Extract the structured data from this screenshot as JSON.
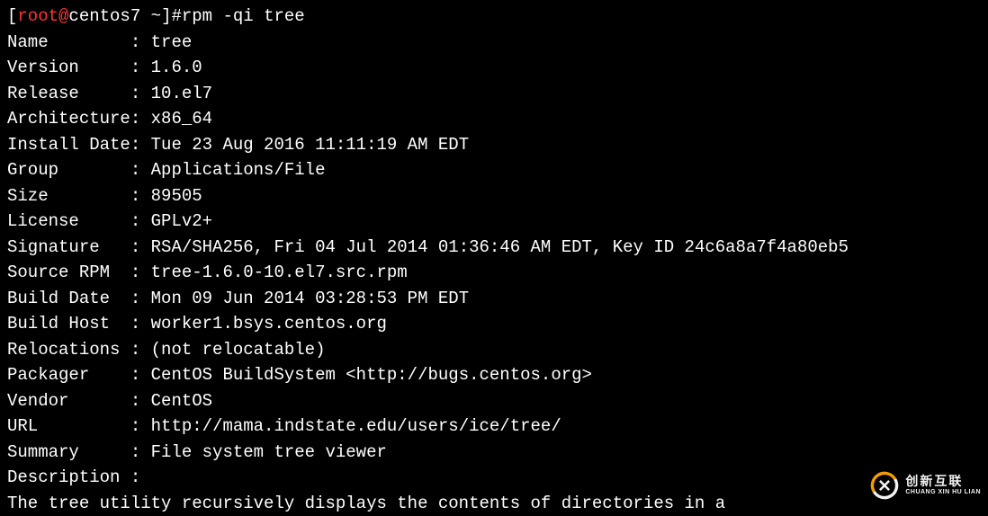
{
  "prompt": {
    "open_bracket": "[",
    "user": "root",
    "at": "@",
    "host": "centos7",
    "space1": " ",
    "path": "~",
    "close_bracket": "]",
    "hash": "#",
    "command": "rpm -qi tree"
  },
  "fields": {
    "name": {
      "label": "Name        ",
      "sep": ": ",
      "value": "tree"
    },
    "version": {
      "label": "Version     ",
      "sep": ": ",
      "value": "1.6.0"
    },
    "release": {
      "label": "Release     ",
      "sep": ": ",
      "value": "10.el7"
    },
    "architecture": {
      "label": "Architecture",
      "sep": ": ",
      "value": "x86_64"
    },
    "install_date": {
      "label": "Install Date",
      "sep": ": ",
      "value": "Tue 23 Aug 2016 11:11:19 AM EDT"
    },
    "group": {
      "label": "Group       ",
      "sep": ": ",
      "value": "Applications/File"
    },
    "size": {
      "label": "Size        ",
      "sep": ": ",
      "value": "89505"
    },
    "license": {
      "label": "License     ",
      "sep": ": ",
      "value": "GPLv2+"
    },
    "signature": {
      "label": "Signature   ",
      "sep": ": ",
      "value": "RSA/SHA256, Fri 04 Jul 2014 01:36:46 AM EDT, Key ID 24c6a8a7f4a80eb5"
    },
    "source_rpm": {
      "label": "Source RPM  ",
      "sep": ": ",
      "value": "tree-1.6.0-10.el7.src.rpm"
    },
    "build_date": {
      "label": "Build Date  ",
      "sep": ": ",
      "value": "Mon 09 Jun 2014 03:28:53 PM EDT"
    },
    "build_host": {
      "label": "Build Host  ",
      "sep": ": ",
      "value": "worker1.bsys.centos.org"
    },
    "relocations": {
      "label": "Relocations ",
      "sep": ": ",
      "value": "(not relocatable)"
    },
    "packager": {
      "label": "Packager    ",
      "sep": ": ",
      "value": "CentOS BuildSystem <http://bugs.centos.org>"
    },
    "vendor": {
      "label": "Vendor      ",
      "sep": ": ",
      "value": "CentOS"
    },
    "url": {
      "label": "URL         ",
      "sep": ": ",
      "value": "http://mama.indstate.edu/users/ice/tree/"
    },
    "summary": {
      "label": "Summary     ",
      "sep": ": ",
      "value": "File system tree viewer"
    },
    "description": {
      "label": "Description ",
      "sep": ":",
      "value": ""
    }
  },
  "description_body": "The tree utility recursively displays the contents of directories in a",
  "watermark": {
    "cn": "创新互联",
    "en": "CHUANG XIN HU LIAN"
  }
}
